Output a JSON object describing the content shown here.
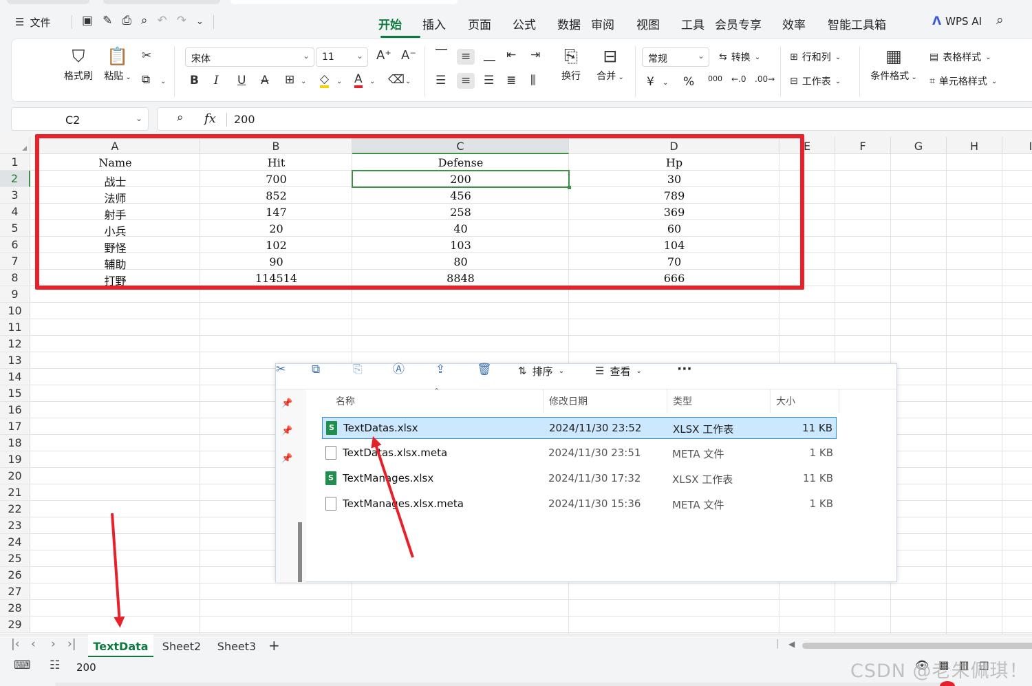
{
  "menubar": {
    "file_label": "文件",
    "tabs": [
      "开始",
      "插入",
      "页面",
      "公式",
      "数据",
      "审阅",
      "视图",
      "工具",
      "会员专享",
      "效率",
      "智能工具箱"
    ],
    "active_tab": "开始",
    "ai_label": "WPS AI"
  },
  "ribbon": {
    "format_painter": "格式刷",
    "paste": "粘贴",
    "font_name": "宋体",
    "font_size": "11",
    "wrap": "换行",
    "merge": "合并",
    "number_format": "常规",
    "convert": "转换",
    "row_col": "行和列",
    "worksheet": "工作表",
    "cond_format": "条件格式",
    "table_style": "表格样式",
    "cell_style": "单元格样式",
    "currency_symbol": "¥",
    "percent_symbol": "%",
    "thousands_symbol": "000"
  },
  "formula_bar": {
    "cell_ref": "C2",
    "fx": "fx",
    "value": "200"
  },
  "sheet": {
    "columns": [
      "A",
      "B",
      "C",
      "D",
      "E",
      "F",
      "G",
      "H",
      "I"
    ],
    "selected_column": "C",
    "rows": [
      "1",
      "2",
      "3",
      "4",
      "5",
      "6",
      "7",
      "8",
      "9",
      "10",
      "11",
      "12",
      "13",
      "14",
      "15",
      "16",
      "17",
      "18",
      "19",
      "20",
      "21",
      "22",
      "23",
      "24",
      "25",
      "26",
      "27",
      "28",
      "29"
    ],
    "selected_row": "2",
    "data": [
      [
        "Name",
        "Hit",
        "Defense",
        "Hp"
      ],
      [
        "战士",
        "700",
        "200",
        "30"
      ],
      [
        "法师",
        "852",
        "456",
        "789"
      ],
      [
        "射手",
        "147",
        "258",
        "369"
      ],
      [
        "小兵",
        "20",
        "40",
        "60"
      ],
      [
        "野怪",
        "102",
        "103",
        "104"
      ],
      [
        "辅助",
        "90",
        "80",
        "70"
      ],
      [
        "打野",
        "114514",
        "8848",
        "666"
      ]
    ]
  },
  "explorer": {
    "sort_label": "排序",
    "view_label": "查看",
    "headers": {
      "name": "名称",
      "date": "修改日期",
      "type": "类型",
      "size": "大小"
    },
    "files": [
      {
        "name": "TextDatas.xlsx",
        "date": "2024/11/30 23:52",
        "type": "XLSX 工作表",
        "size": "11 KB",
        "kind": "xlsx",
        "selected": true
      },
      {
        "name": "TextDatas.xlsx.meta",
        "date": "2024/11/30 23:51",
        "type": "META 文件",
        "size": "1 KB",
        "kind": "meta",
        "selected": false
      },
      {
        "name": "TextManages.xlsx",
        "date": "2024/11/30 17:32",
        "type": "XLSX 工作表",
        "size": "11 KB",
        "kind": "xlsx",
        "selected": false
      },
      {
        "name": "TextManages.xlsx.meta",
        "date": "2024/11/30 15:36",
        "type": "META 文件",
        "size": "1 KB",
        "kind": "meta",
        "selected": false
      }
    ]
  },
  "sheet_tabs": [
    "TextData",
    "Sheet2",
    "Sheet3"
  ],
  "active_sheet": "TextData",
  "status": {
    "value": "200"
  },
  "watermark": "CSDN @老朱佩琪！",
  "colors": {
    "accent_green": "#0c7a3e",
    "highlight_red": "#e8202a",
    "selection_blue": "#cce8ff"
  }
}
